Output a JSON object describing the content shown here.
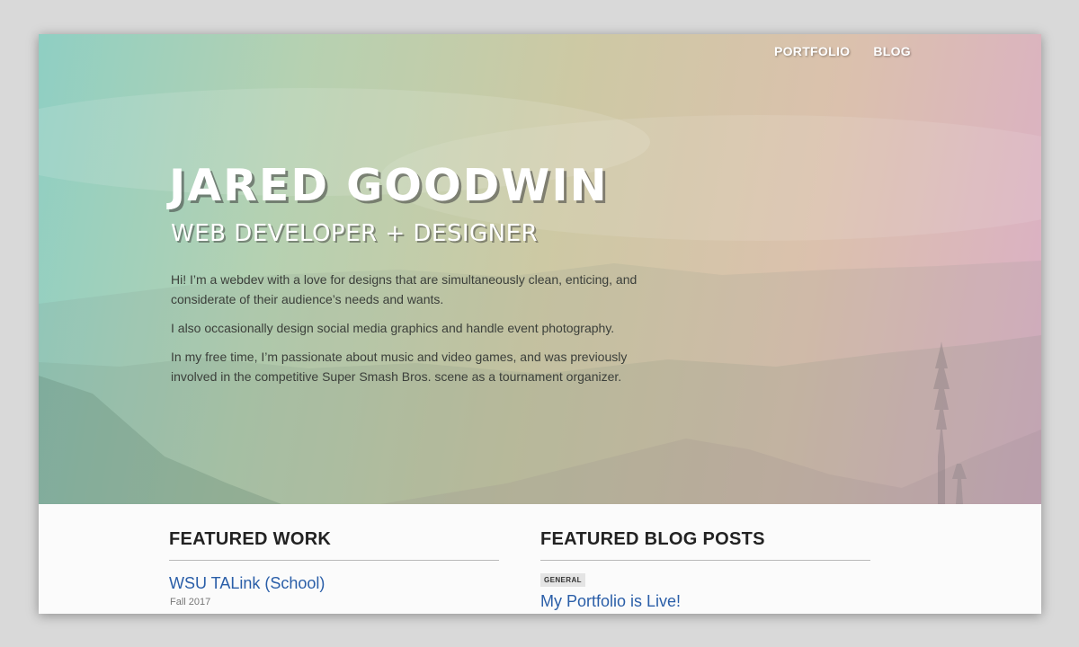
{
  "nav": {
    "items": [
      {
        "label": "PORTFOLIO"
      },
      {
        "label": "BLOG"
      }
    ]
  },
  "hero": {
    "name": "JARED GOODWIN",
    "subtitle": "WEB DEVELOPER + DESIGNER",
    "bio": [
      "Hi! I’m a webdev with a love for designs that are simultaneously clean, enticing, and considerate of their audience’s needs and wants.",
      "I also occasionally design social media graphics and handle event photography.",
      "In my free time, I’m passionate about music and video games, and was previously involved in the competitive Super Smash Bros. scene as a tournament organizer."
    ]
  },
  "featured_work": {
    "heading": "FEATURED WORK",
    "items": [
      {
        "title": "WSU TALink (School)",
        "date": "Fall 2017"
      }
    ]
  },
  "featured_blog": {
    "heading": "FEATURED BLOG POSTS",
    "items": [
      {
        "tag": "GENERAL",
        "title": "My Portfolio is Live!"
      }
    ]
  },
  "colors": {
    "link": "#2a5ea8",
    "heading": "#222222",
    "gradient": [
      "#8fcfc3",
      "#b6d1b1",
      "#cdc9a4",
      "#dbc1ad",
      "#dbafc6"
    ]
  },
  "icons": [
    "mountain-landscape-background"
  ]
}
